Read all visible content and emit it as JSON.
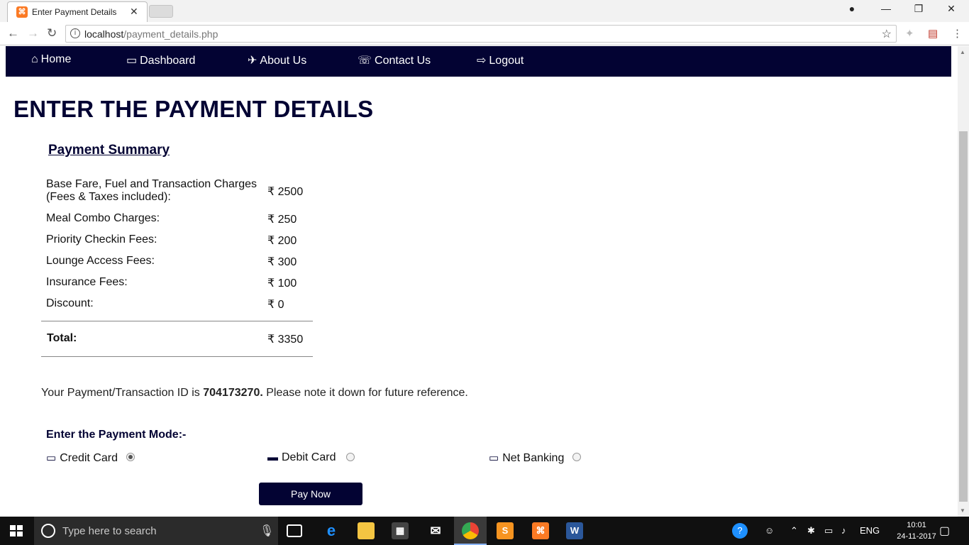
{
  "browser": {
    "tab_title": "Enter Payment Details",
    "url_host": "localhost",
    "url_path": "/payment_details.php"
  },
  "navbar": {
    "items": [
      {
        "label": "Home",
        "icon": "home-icon"
      },
      {
        "label": "Dashboard",
        "icon": "monitor-icon"
      },
      {
        "label": "About Us",
        "icon": "plane-icon"
      },
      {
        "label": "Contact Us",
        "icon": "phone-icon"
      },
      {
        "label": "Logout",
        "icon": "logout-icon"
      }
    ]
  },
  "page": {
    "title": "ENTER THE PAYMENT DETAILS",
    "summary_title": "Payment Summary",
    "rows": [
      {
        "label": "Base Fare, Fuel and Transaction Charges (Fees & Taxes included):",
        "value": "₹ 2500"
      },
      {
        "label": "Meal Combo Charges:",
        "value": "₹ 250"
      },
      {
        "label": "Priority Checkin Fees:",
        "value": "₹ 200"
      },
      {
        "label": "Lounge Access Fees:",
        "value": "₹ 300"
      },
      {
        "label": "Insurance Fees:",
        "value": "₹ 100"
      },
      {
        "label": "Discount:",
        "value": "₹ 0"
      }
    ],
    "total_label": "Total:",
    "total_value": "₹ 3350",
    "txn_prefix": "Your Payment/Transaction ID is ",
    "txn_id": "704173270.",
    "txn_suffix": " Please note it down for future reference.",
    "mode_title": "Enter the Payment Mode:-",
    "modes": [
      {
        "label": "Credit Card",
        "icon": "credit-card-icon",
        "selected": true
      },
      {
        "label": "Debit Card",
        "icon": "debit-card-icon",
        "selected": false
      },
      {
        "label": "Net Banking",
        "icon": "monitor-icon",
        "selected": false
      }
    ],
    "pay_button": "Pay Now"
  },
  "taskbar": {
    "search_placeholder": "Type here to search",
    "language": "ENG",
    "time": "10:01",
    "date": "24-11-2017"
  },
  "colors": {
    "brand_navy": "#030333"
  }
}
